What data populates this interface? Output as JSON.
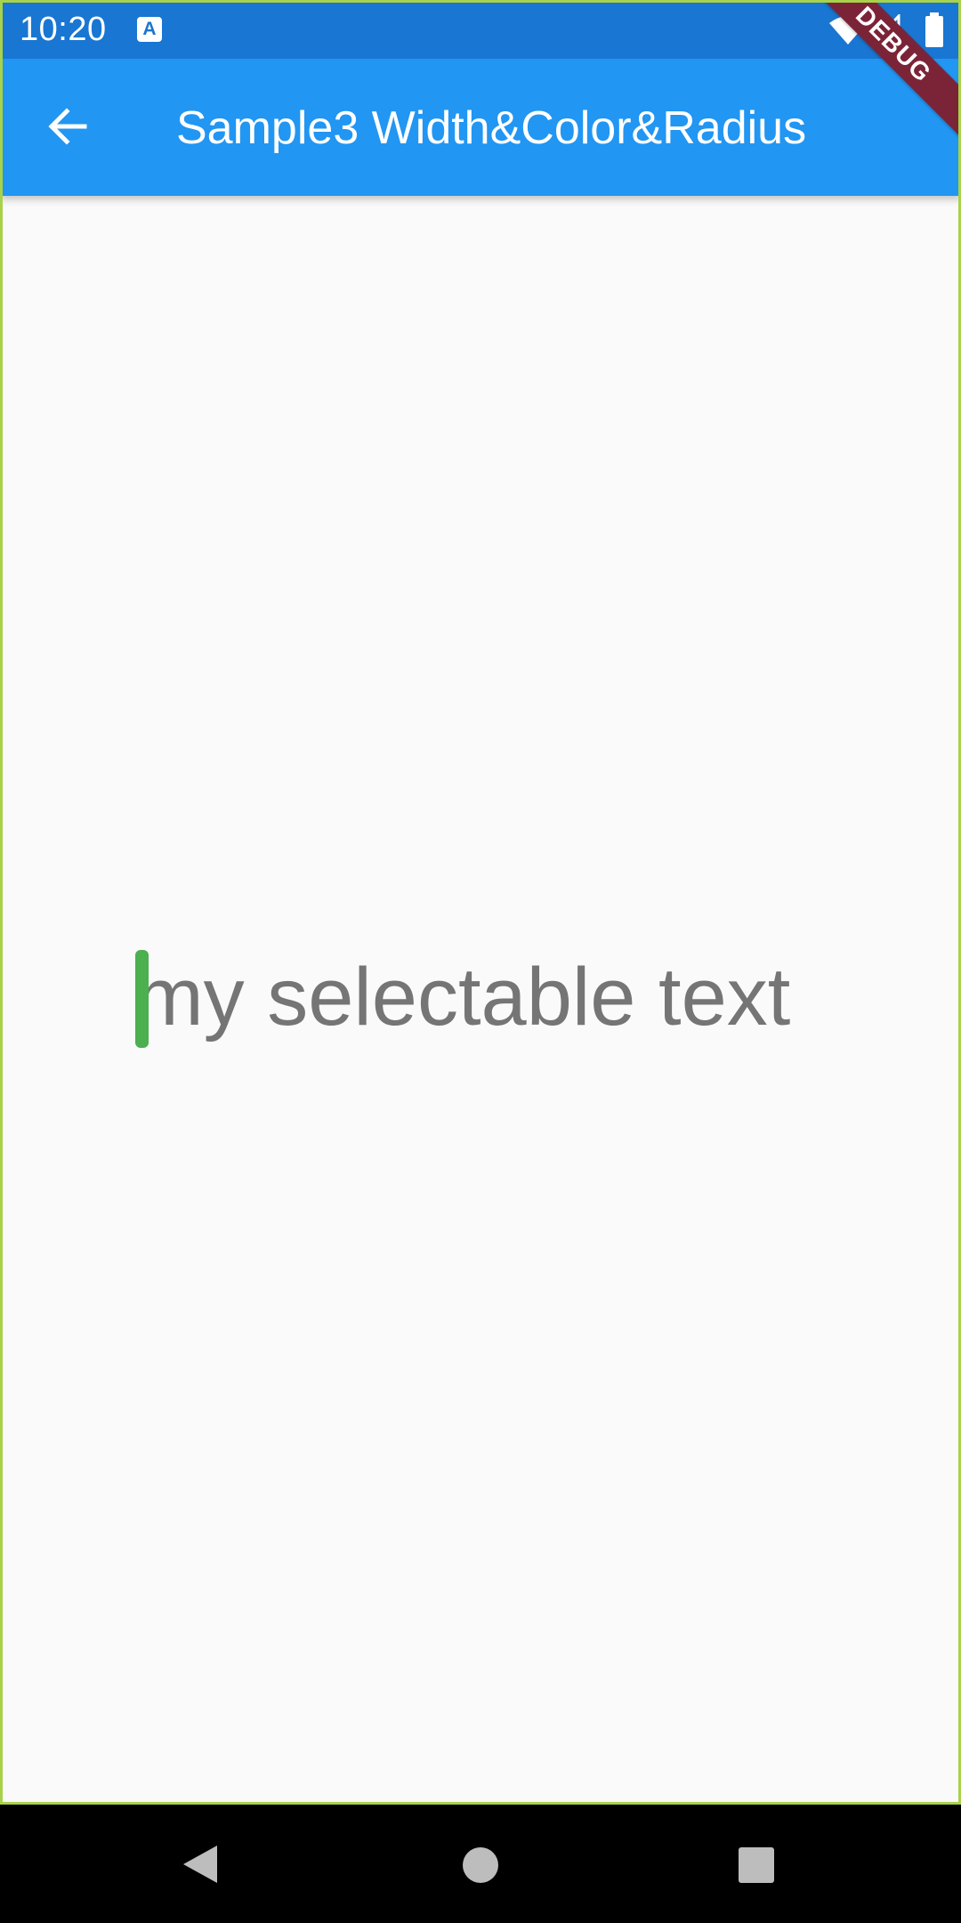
{
  "status_bar": {
    "time": "10:20",
    "notification_icon_letter": "A",
    "icons": [
      "wifi-icon",
      "signal-icon",
      "battery-icon"
    ]
  },
  "app_bar": {
    "title": "Sample3 Width&Color&Radius",
    "back_icon": "arrow-back-icon",
    "color": "#2196f3"
  },
  "debug_banner": {
    "label": "DEBUG",
    "color": "#7b2438"
  },
  "content": {
    "selectable_text": "my selectable text",
    "text_color": "#757575",
    "cursor_color": "#4caf50"
  },
  "nav_bar": {
    "buttons": [
      "nav-back-icon",
      "nav-home-icon",
      "nav-recents-icon"
    ]
  }
}
